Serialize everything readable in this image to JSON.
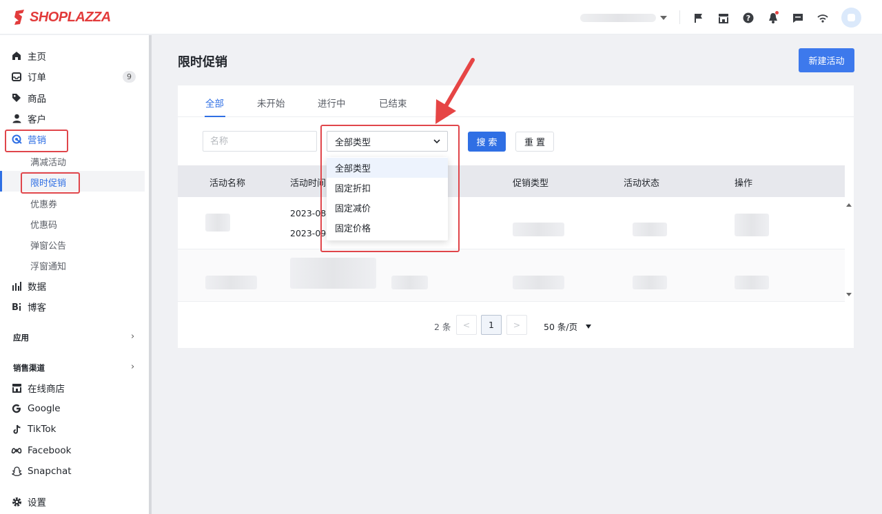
{
  "brand": {
    "name": "SHOPLAZZA",
    "color": "#e23b3b"
  },
  "topbar": {
    "icons": [
      "flag-icon",
      "store-icon",
      "help-icon",
      "bell-icon",
      "message-icon",
      "wifi-icon"
    ]
  },
  "sidebar": {
    "items": [
      {
        "label": "主页",
        "icon": "home-icon"
      },
      {
        "label": "订单",
        "icon": "inbox-icon",
        "badge": "9"
      },
      {
        "label": "商品",
        "icon": "tag-icon"
      },
      {
        "label": "客户",
        "icon": "person-icon"
      },
      {
        "label": "营销",
        "icon": "target-icon"
      }
    ],
    "marketing_sub": [
      "满减活动",
      "限时促销",
      "优惠券",
      "优惠码",
      "弹窗公告",
      "浮窗通知"
    ],
    "items2": [
      {
        "label": "数据",
        "icon": "bar-chart-icon"
      },
      {
        "label": "博客",
        "icon": "blog-icon"
      }
    ],
    "section_apps": "应用",
    "section_channels": "销售渠道",
    "channels": [
      {
        "label": "在线商店",
        "icon": "store-icon"
      },
      {
        "label": "Google",
        "icon": "google-icon"
      },
      {
        "label": "TikTok",
        "icon": "tiktok-icon"
      },
      {
        "label": "Facebook",
        "icon": "facebook-icon"
      },
      {
        "label": "Snapchat",
        "icon": "snapchat-icon"
      }
    ],
    "settings": "设置"
  },
  "main": {
    "title": "限时促销",
    "new_button": "新建活动",
    "tabs": [
      "全部",
      "未开始",
      "进行中",
      "已结束"
    ],
    "filter": {
      "name_placeholder": "名称",
      "type_value": "全部类型",
      "search": "搜索",
      "reset": "重置"
    },
    "dropdown": [
      "全部类型",
      "固定折扣",
      "固定减价",
      "固定价格"
    ],
    "table": {
      "headers": [
        "活动名称",
        "活动时间",
        "促销类型",
        "活动状态",
        "操作"
      ],
      "row1_time": [
        "2023-08-",
        "2023-09-"
      ]
    },
    "pagination": {
      "total": "2 条",
      "prev": "<",
      "current": "1",
      "next": ">",
      "page_size": "50 条/页"
    }
  },
  "colors": {
    "accent": "#2f6fe4",
    "highlight": "#e0454a"
  }
}
